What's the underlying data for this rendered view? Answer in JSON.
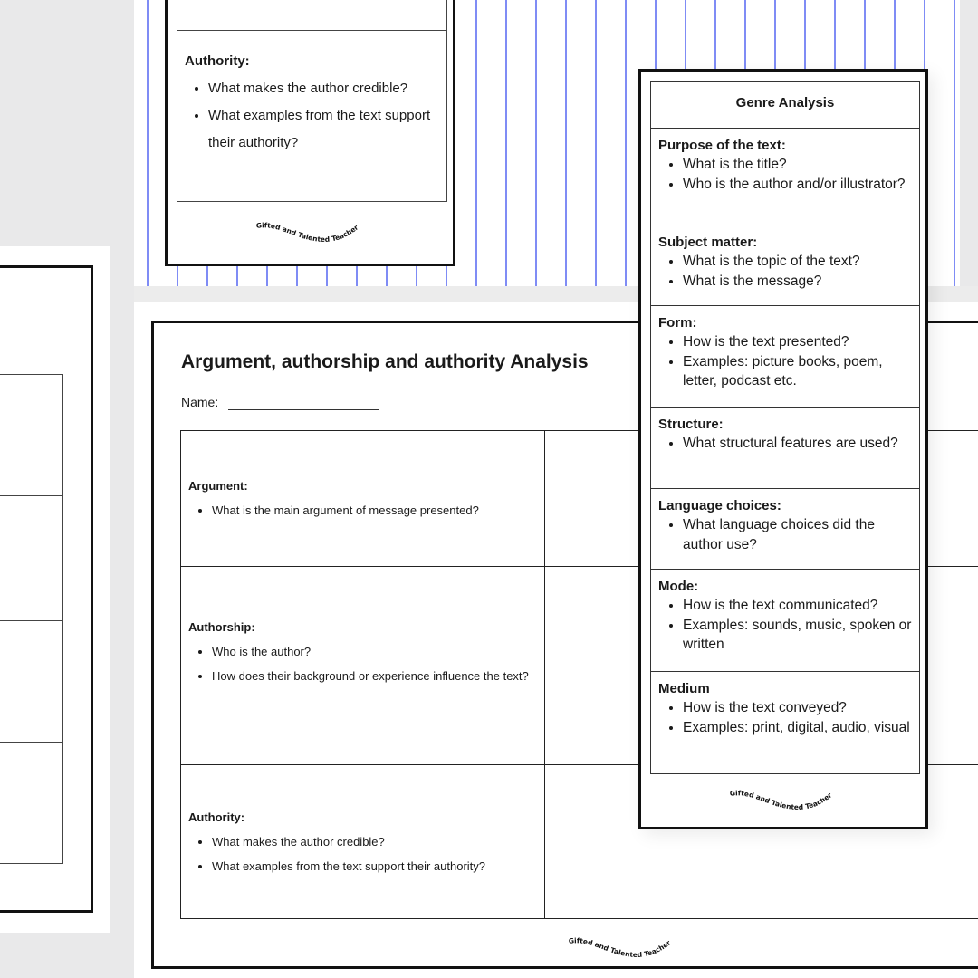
{
  "stripes": {
    "color": "#7f8cf5"
  },
  "top_card": {
    "section": {
      "heading": "Authority:",
      "bullets": [
        "What makes the author credible?",
        "What examples from the text support their authority?"
      ]
    },
    "logo": "Gifted and Talented Teacher"
  },
  "main_sheet": {
    "title": "Argument, authorship and authority Analysis",
    "name_label": "Name:",
    "rows": [
      {
        "heading": "Argument:",
        "bullets": [
          "What is the main argument of message presented?"
        ]
      },
      {
        "heading": "Authorship:",
        "bullets": [
          "Who is the author?",
          "How does their background or experience influence the text?"
        ]
      },
      {
        "heading": "Authority:",
        "bullets": [
          "What makes the author credible?",
          "What examples from the text support their authority?"
        ]
      }
    ],
    "logo": "Gifted and Talented Teacher"
  },
  "genre_card": {
    "title": "Genre Analysis",
    "sections": [
      {
        "heading": "Purpose of the text:",
        "bullets": [
          "What is the title?",
          "Who is the author and/or illustrator?"
        ]
      },
      {
        "heading": "Subject matter:",
        "bullets": [
          "What is the topic of the text?",
          "What is the message?"
        ]
      },
      {
        "heading": "Form:",
        "bullets": [
          "How is the text presented?",
          "Examples: picture books, poem, letter, podcast etc."
        ]
      },
      {
        "heading": "Structure:",
        "bullets": [
          "What structural features are used?"
        ]
      },
      {
        "heading": "Language choices:",
        "bullets": [
          "What language choices did the author use?"
        ]
      },
      {
        "heading": "Mode:",
        "bullets": [
          "How is the text communicated?",
          "Examples: sounds, music, spoken or written"
        ]
      },
      {
        "heading": "Medium",
        "bullets": [
          "How is the text conveyed?",
          "Examples: print, digital, audio, visual"
        ]
      }
    ],
    "logo": "Gifted and Talented Teacher"
  }
}
